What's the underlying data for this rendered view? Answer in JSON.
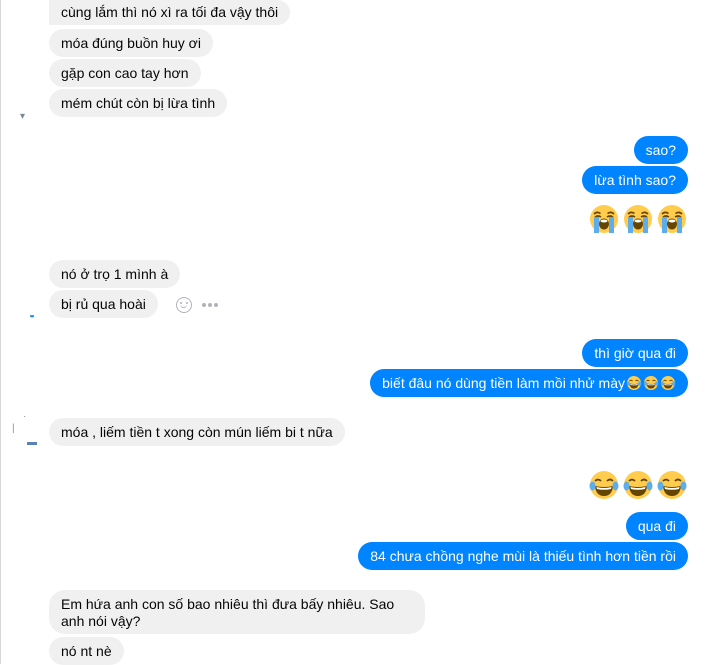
{
  "messages": {
    "m1": "cùng lắm thì nó xì ra tối đa vậy thôi",
    "m2": "móa đúng buồn huy ơi",
    "m3": "gặp con cao tay hơn",
    "m4": "mém chút còn bị lừa tình",
    "m5": "sao?",
    "m6": "lừa tình sao?",
    "m7": "nó ở trọ 1 mình à",
    "m8": "bị rủ qua hoài",
    "m9": "thì giờ qua đi",
    "m10": "biết đâu nó dùng tiền làm mồi nhử mày",
    "m11": "móa , liếm tiền t xong còn mún liếm bi t  nữa",
    "m12": "qua đi",
    "m13": "84 chưa chồng nghe mùi là thiếu tình hơn tiền rồi",
    "m14": "Em hứa anh con số bao nhiêu thì đưa bấy nhiêu. Sao anh nói vậy?",
    "m15": "nó nt nè"
  },
  "icons": {
    "cry": "loudly-crying-face-emoji",
    "laugh": "tears-of-joy-emoji",
    "react": "smiley-react-icon",
    "more": "more-dots-icon"
  },
  "colors": {
    "outgoing": "#0084ff",
    "incoming": "#f0f0f0",
    "emoji_face": "#ffcc4d",
    "tears": "#5dadec"
  }
}
